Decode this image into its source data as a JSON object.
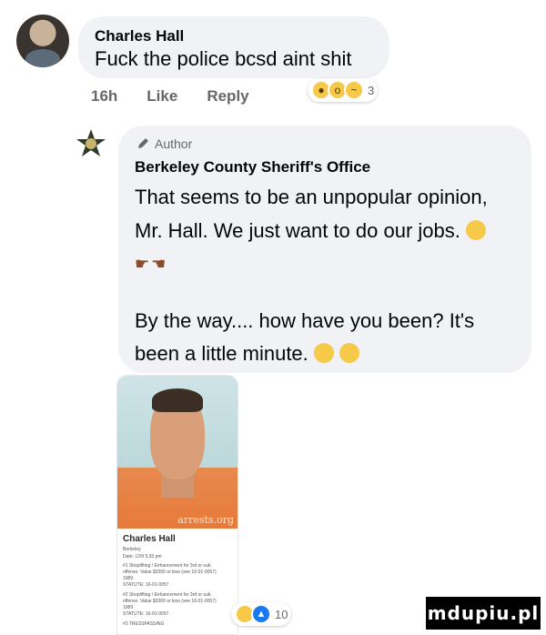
{
  "comment1": {
    "author": "Charles Hall",
    "text": "Fuck the police bcsd aint shit",
    "time": "16h",
    "like_label": "Like",
    "reply_label": "Reply",
    "reaction_count": "3"
  },
  "comment2": {
    "badge": "Author",
    "author": "Berkeley County Sheriff's Office",
    "line1": "That seems to be an unpopular opinion,",
    "line2": "Mr. Hall. We just want to do our jobs.",
    "line3": "By the way.... how have you been? It's",
    "line4": "been a little minute."
  },
  "mugshot": {
    "watermark": "arrests.org",
    "name": "Charles Hall",
    "agency": "Berkeley",
    "date": "Date: 12/9 5:33 pm",
    "line1": "#1 Shoplifting / Enhancement for 3rd or sub.",
    "line2": "offense. Value $2000 or less (see 16-01-0057)",
    "line3": "1989",
    "line4": "STATUTE: 16-01-0057",
    "line5": "#2 Shoplifting / Enhancement for 3rd or sub.",
    "line6": "offense. Value $2000 or less (see 16-01-0057)",
    "line7": "1989",
    "line8": "STATUTE: 16-01-0057",
    "line9": "#3 TRESSPASSING"
  },
  "reply_reactions": {
    "count": "10"
  },
  "site_watermark": "mdupiu.pl",
  "colors": {
    "bubble": "#f0f2f5",
    "meta": "#65676b",
    "like_blue": "#1877f2"
  }
}
